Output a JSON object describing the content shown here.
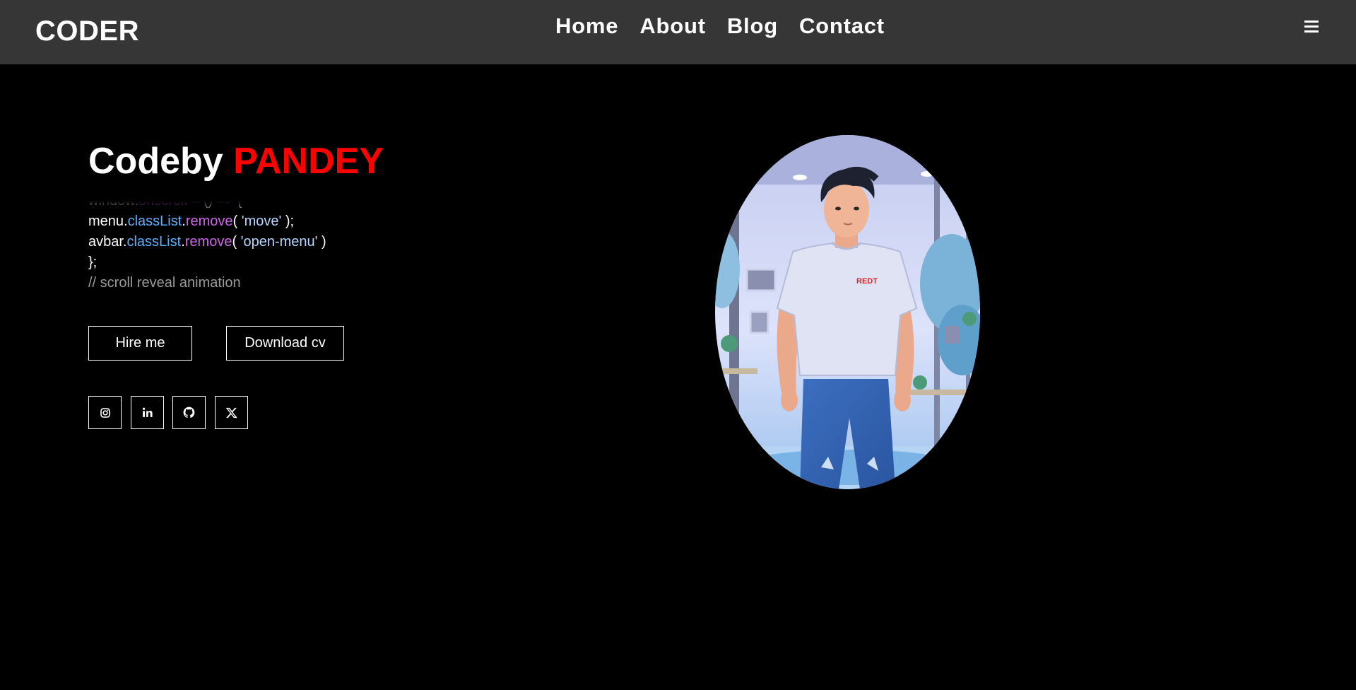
{
  "header": {
    "logo": "CODER",
    "nav": [
      "Home",
      "About",
      "Blog",
      "Contact"
    ]
  },
  "hero": {
    "title_prefix": "Codeby ",
    "title_accent": "PANDEY",
    "code_lines": [
      [
        [
          "c-default",
          "window."
        ],
        [
          "c-fn",
          "onscroll"
        ],
        [
          "c-op",
          " = "
        ],
        [
          "c-default",
          "() "
        ],
        [
          "c-op",
          "=> "
        ],
        [
          "c-default",
          "{"
        ]
      ],
      [
        [
          "c-default",
          "menu."
        ],
        [
          "c-prop",
          "classList"
        ],
        [
          "c-default",
          "."
        ],
        [
          "c-fn",
          "remove"
        ],
        [
          "c-default",
          "( "
        ],
        [
          "c-str",
          "'move'"
        ],
        [
          "c-default",
          " );"
        ]
      ],
      [
        [
          "c-default",
          "avbar."
        ],
        [
          "c-prop",
          "classList"
        ],
        [
          "c-default",
          "."
        ],
        [
          "c-fn",
          "remove"
        ],
        [
          "c-default",
          "( "
        ],
        [
          "c-str",
          "'open-menu'"
        ],
        [
          "c-default",
          " )"
        ]
      ],
      [
        [
          "c-default",
          "};"
        ]
      ],
      [
        [
          "c-comment",
          "// scroll reveal animation"
        ]
      ]
    ],
    "buttons": {
      "hire": "Hire me",
      "cv": "Download cv"
    },
    "socials": [
      "instagram-icon",
      "linkedin-icon",
      "github-icon",
      "x-icon"
    ],
    "portrait_shirt_text": "REDT"
  },
  "colors": {
    "header_bg": "#363636",
    "accent": "#ff0000",
    "page_bg": "#000000"
  }
}
